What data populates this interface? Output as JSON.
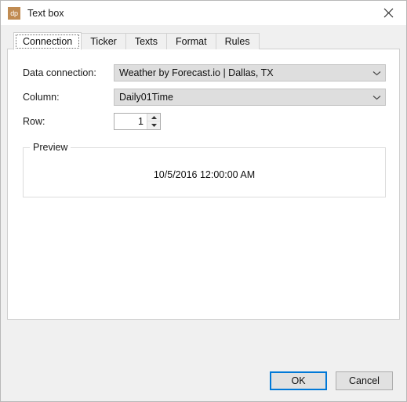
{
  "window": {
    "title": "Text box",
    "app_icon_label": "dp",
    "close_label": "✕"
  },
  "tabs": [
    {
      "label": "Connection",
      "selected": true
    },
    {
      "label": "Ticker",
      "selected": false
    },
    {
      "label": "Texts",
      "selected": false
    },
    {
      "label": "Format",
      "selected": false
    },
    {
      "label": "Rules",
      "selected": false
    }
  ],
  "form": {
    "data_connection": {
      "label": "Data connection:",
      "value": "Weather by Forecast.io | Dallas, TX"
    },
    "column": {
      "label": "Column:",
      "value": "Daily01Time"
    },
    "row": {
      "label": "Row:",
      "value": "1"
    }
  },
  "preview": {
    "title": "Preview",
    "text": "10/5/2016 12:00:00 AM"
  },
  "footer": {
    "ok_label": "OK",
    "cancel_label": "Cancel"
  },
  "colors": {
    "accent": "#0078d7",
    "app_icon_bg": "#c08b52",
    "window_bg": "#f0f0f0",
    "panel_bg": "#ffffff",
    "combo_bg": "#dedede"
  }
}
